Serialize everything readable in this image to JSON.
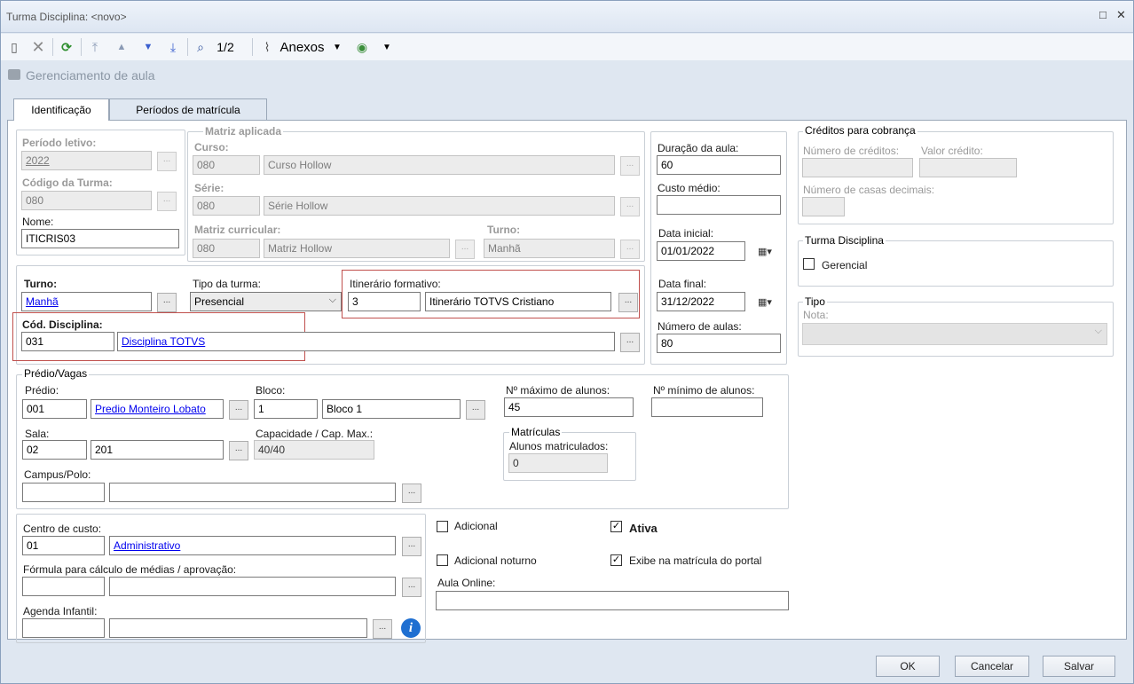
{
  "window": {
    "title": "Turma Disciplina: <novo>",
    "restore": "□",
    "close": "✕"
  },
  "toolbar": {
    "page_indicator": "1/2",
    "attachments_label": "Anexos"
  },
  "subheader": {
    "label": "Gerenciamento de aula"
  },
  "tabs": [
    {
      "label": "Identificação"
    },
    {
      "label": "Períodos de matrícula"
    }
  ],
  "identification": {
    "periodo_label": "Período letivo:",
    "periodo_value": "2022",
    "codigo_label": "Código da Turma:",
    "codigo_value": "080",
    "nome_label": "Nome:",
    "nome_value": "ITICRIS03"
  },
  "matriz": {
    "title": "Matriz aplicada",
    "curso_label": "Curso:",
    "curso_code": "080",
    "curso_name": "Curso Hollow",
    "serie_label": "Série:",
    "serie_code": "080",
    "serie_name": "Série Hollow",
    "matriz_label": "Matriz curricular:",
    "matriz_code": "080",
    "matriz_name": "Matriz Hollow",
    "turno_label": "Turno:",
    "turno_value": "Manhã"
  },
  "turma": {
    "turno_label": "Turno:",
    "turno_value": "Manhã",
    "tipo_label": "Tipo da turma:",
    "tipo_value": "Presencial",
    "itinerario_label": "Itinerário formativo:",
    "itinerario_code": "3",
    "itinerario_name": "Itinerário TOTVS Cristiano",
    "disciplina_label": "Cód. Disciplina:",
    "disciplina_code": "031",
    "disciplina_name": "Disciplina TOTVS"
  },
  "datas": {
    "duracao_label": "Duração da aula:",
    "duracao_value": "60",
    "custo_label": "Custo médio:",
    "custo_value": "",
    "inicio_label": "Data inicial:",
    "inicio_value": "01/01/2022",
    "fim_label": "Data final:",
    "fim_value": "31/12/2022",
    "num_aulas_label": "Número de aulas:",
    "num_aulas_value": "80"
  },
  "creditos": {
    "title": "Créditos para cobrança",
    "num_label": "Número de créditos:",
    "valor_label": "Valor crédito:",
    "casas_label": "Número de casas decimais:"
  },
  "turma_disciplina": {
    "title": "Turma Disciplina",
    "gerencial_label": "Gerencial"
  },
  "tipo": {
    "title": "Tipo",
    "nota_label": "Nota:"
  },
  "predio": {
    "title": "Prédio/Vagas",
    "predio_label": "Prédio:",
    "predio_code": "001",
    "predio_name": "Predio Monteiro Lobato",
    "bloco_label": "Bloco:",
    "bloco_code": "1",
    "bloco_name": "Bloco 1",
    "max_label": "Nº máximo de alunos:",
    "max_value": "45",
    "min_label": "Nº mínimo de alunos:",
    "min_value": "",
    "sala_label": "Sala:",
    "sala_code": "02",
    "sala_name": "201",
    "capacidade_label": "Capacidade / Cap. Max.:",
    "capacidade_value": "40/40",
    "matriculas_title": "Matrículas",
    "matriculados_label": "Alunos matriculados:",
    "matriculados_value": "0",
    "campus_label": "Campus/Polo:"
  },
  "custo": {
    "centro_label": "Centro de custo:",
    "centro_code": "01",
    "centro_name": "Administrativo",
    "formula_label": "Fórmula para cálculo de médias / aprovação:",
    "agenda_label": "Agenda Infantil:"
  },
  "options": {
    "adicional_label": "Adicional",
    "ativa_label": "Ativa",
    "noturno_label": "Adicional noturno",
    "exibe_label": "Exibe na matrícula do portal",
    "online_label": "Aula Online:"
  },
  "footer": {
    "ok": "OK",
    "cancel": "Cancelar",
    "save": "Salvar"
  },
  "colors": {
    "accent": "#0000ee",
    "highlight": "#c0504d",
    "frame": "#dfe7f1"
  }
}
